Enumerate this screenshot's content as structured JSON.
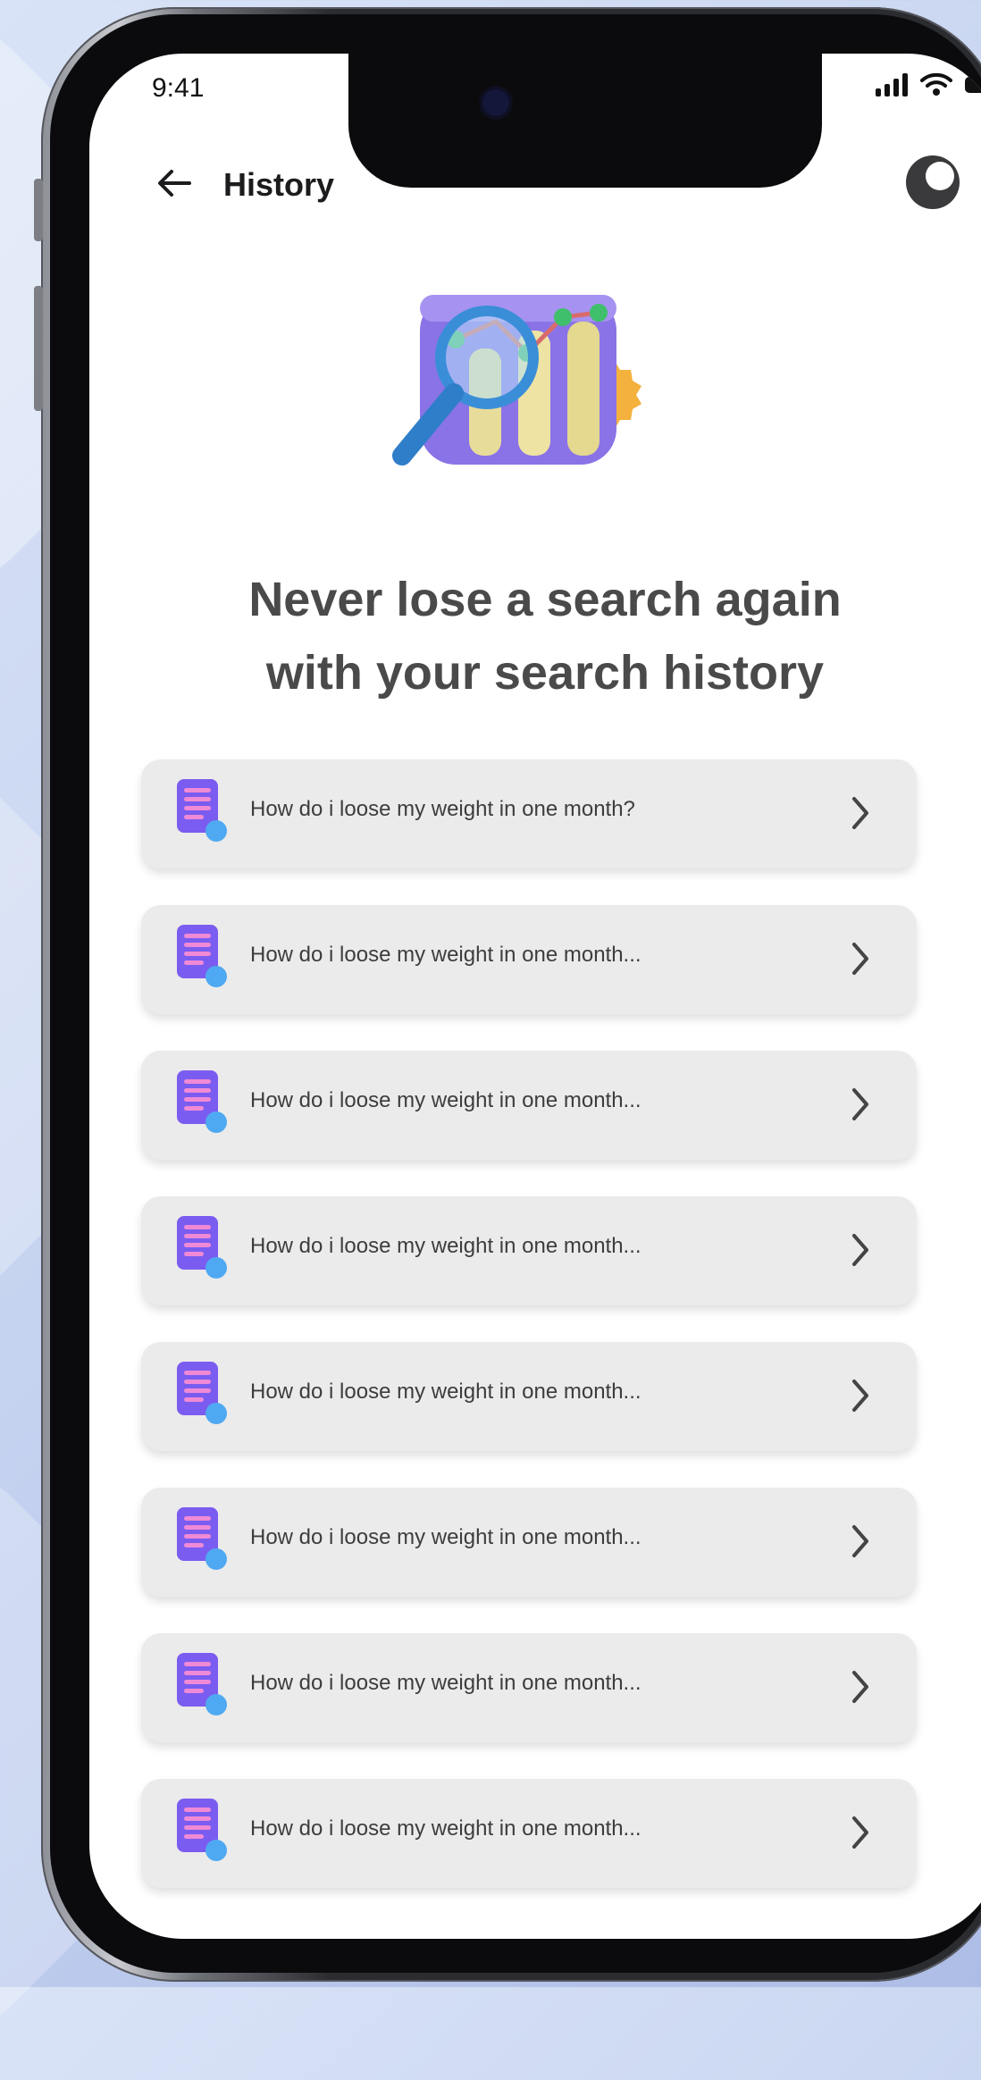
{
  "status_bar": {
    "time": "9:41"
  },
  "header": {
    "title": "History"
  },
  "headline": {
    "line1": "Never lose a search again",
    "line2": "with your search history"
  },
  "history": {
    "items": [
      {
        "query": "How do i loose my weight in one month?"
      },
      {
        "query": "How do i loose my weight in one month..."
      },
      {
        "query": "How do i loose my weight in one month..."
      },
      {
        "query": "How do i loose my weight in one month..."
      },
      {
        "query": "How do i loose my weight in one month..."
      },
      {
        "query": "How do i loose my weight in one month..."
      },
      {
        "query": "How do i loose my weight in one month..."
      },
      {
        "query": "How do i loose my weight in one month..."
      }
    ]
  },
  "icons": {
    "back": "arrow-left-icon",
    "theme": "half-moon-icon",
    "item": "document-search-icon",
    "chevron": "chevron-right-icon"
  },
  "colors": {
    "doc_icon": "#7b5cf0",
    "doc_lines": "#f08ad6",
    "doc_badge": "#4fa9f2",
    "card_bg": "#ebebeb"
  }
}
